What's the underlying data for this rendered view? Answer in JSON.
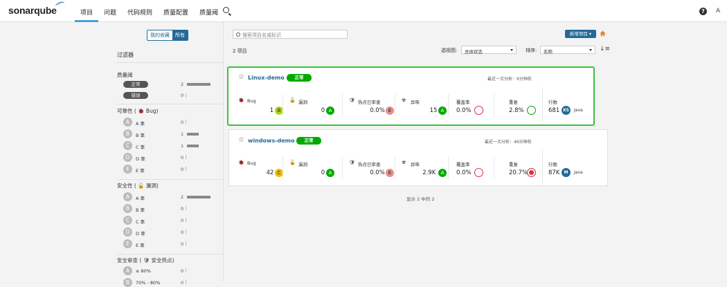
{
  "header": {
    "logo": "sonarqube",
    "nav": [
      "项目",
      "问题",
      "代码规则",
      "质量配置",
      "质量阈"
    ],
    "help": "?",
    "avatar": "A"
  },
  "sidebar": {
    "fav_toggle": {
      "off": "我的收藏",
      "on": "所有"
    },
    "filters_title": "过滤器",
    "quality_gate": {
      "title": "质量阈",
      "items": [
        {
          "label": "正常",
          "count": "2",
          "share": 1.0
        },
        {
          "label": "错误",
          "count": "0",
          "share": 0
        }
      ]
    },
    "reliability": {
      "title": "可靠性 ( ",
      "title_icon": "bug-icon",
      "title_suffix": " Bug)",
      "items": [
        {
          "letter": "A",
          "label": "A 率",
          "count": "0",
          "share": 0
        },
        {
          "letter": "B",
          "label": "B 率",
          "count": "1",
          "share": 0.5
        },
        {
          "letter": "C",
          "label": "C 率",
          "count": "1",
          "share": 0.5
        },
        {
          "letter": "D",
          "label": "D 率",
          "count": "0",
          "share": 0
        },
        {
          "letter": "E",
          "label": "E 率",
          "count": "0",
          "share": 0
        }
      ]
    },
    "security": {
      "title": "安全性 ( ",
      "title_suffix": " 漏洞)",
      "items": [
        {
          "letter": "A",
          "label": "A 率",
          "count": "2",
          "share": 1.0
        },
        {
          "letter": "B",
          "label": "B 率",
          "count": "0",
          "share": 0
        },
        {
          "letter": "C",
          "label": "C 率",
          "count": "0",
          "share": 0
        },
        {
          "letter": "D",
          "label": "D 率",
          "count": "0",
          "share": 0
        },
        {
          "letter": "E",
          "label": "E 率",
          "count": "0",
          "share": 0
        }
      ]
    },
    "hotspots": {
      "title": "安全审查 ( ",
      "title_suffix": " 安全热点)",
      "items": [
        {
          "letter": "A",
          "label": "≥ 80%",
          "count": "0",
          "share": 0
        },
        {
          "letter": "B",
          "label": "70% - 80%",
          "count": "0",
          "share": 0
        }
      ]
    }
  },
  "toolbar": {
    "search_placeholder": "搜索项目名或标识",
    "new_project": "新增项目 ▾",
    "project_count": "2 项目",
    "perspective_label": "透视图:",
    "perspective_value": "总体状态",
    "sort_label": "排序:",
    "sort_value": "名称",
    "sort_icon": "↓≡"
  },
  "projects": [
    {
      "name": "Linux-demo",
      "gate": "正常",
      "last_analysis": "最近一次分析：9分钟前",
      "metrics": {
        "bugs": {
          "label": "Bug",
          "value": "1",
          "grade": "B"
        },
        "vulns": {
          "label": "漏洞",
          "value": "0",
          "grade": "A"
        },
        "hotspots": {
          "label": "热点已审查",
          "value": "0.0%",
          "grade": "E"
        },
        "smells": {
          "label": "异味",
          "value": "15",
          "grade": "A"
        },
        "coverage": {
          "label": "覆盖率",
          "value": "0.0%"
        },
        "dup": {
          "label": "重复",
          "value": "2.8%"
        },
        "lines": {
          "label": "行数",
          "value": "681",
          "size": "XS",
          "lang": "Java"
        }
      }
    },
    {
      "name": "windows-demo",
      "gate": "正常",
      "last_analysis": "最近一次分析：46分钟前",
      "metrics": {
        "bugs": {
          "label": "Bug",
          "value": "42",
          "grade": "C"
        },
        "vulns": {
          "label": "漏洞",
          "value": "0",
          "grade": "A"
        },
        "hotspots": {
          "label": "热点已审查",
          "value": "0.0%",
          "grade": "E"
        },
        "smells": {
          "label": "异味",
          "value": "2.9K",
          "grade": "A"
        },
        "coverage": {
          "label": "覆盖率",
          "value": "0.0%"
        },
        "dup": {
          "label": "重复",
          "value": "20.7%"
        },
        "lines": {
          "label": "行数",
          "value": "87K",
          "size": "M",
          "lang": "Java"
        }
      }
    }
  ],
  "footer": "显示 2 中的 2",
  "colors": {
    "accent": "#236a97",
    "ok": "#00aa00",
    "highlight": "#3cc13c"
  }
}
